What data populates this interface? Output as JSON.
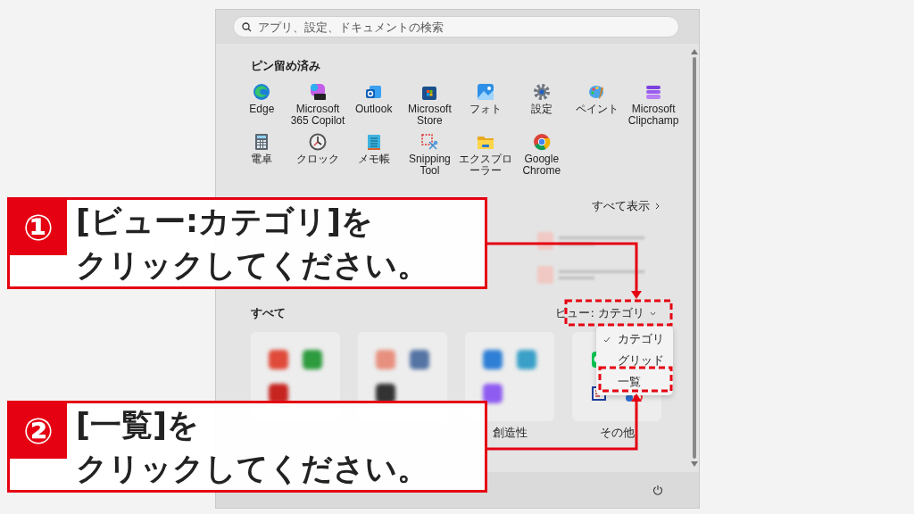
{
  "search": {
    "placeholder": "アプリ、設定、ドキュメントの検索"
  },
  "pinned": {
    "heading": "ピン留め済み",
    "apps": [
      {
        "label": "Edge"
      },
      {
        "label": "Microsoft 365 Copilot"
      },
      {
        "label": "Outlook"
      },
      {
        "label": "Microsoft Store"
      },
      {
        "label": "フォト"
      },
      {
        "label": "設定"
      },
      {
        "label": "ペイント"
      },
      {
        "label": "Microsoft Clipchamp"
      },
      {
        "label": "電卓"
      },
      {
        "label": "クロック"
      },
      {
        "label": "メモ帳"
      },
      {
        "label": "Snipping Tool"
      },
      {
        "label": "エクスプローラー"
      },
      {
        "label": "Google Chrome"
      }
    ]
  },
  "recommended": {
    "show_all": "すべて表示"
  },
  "all_apps": {
    "heading": "すべて",
    "view_button": "ビュー: カテゴリ",
    "menu": [
      {
        "label": "カテゴリ",
        "selected": true
      },
      {
        "label": "グリッド",
        "selected": false
      },
      {
        "label": "一覧",
        "selected": false
      }
    ],
    "categories": [
      {
        "label": "創造性"
      },
      {
        "label": "その他"
      }
    ]
  },
  "callouts": [
    {
      "number": "①",
      "lines": [
        "[ビュー:カテゴリ]を",
        "クリックしてください。"
      ]
    },
    {
      "number": "②",
      "lines": [
        "[一覧]を",
        "クリックしてください。"
      ]
    }
  ]
}
